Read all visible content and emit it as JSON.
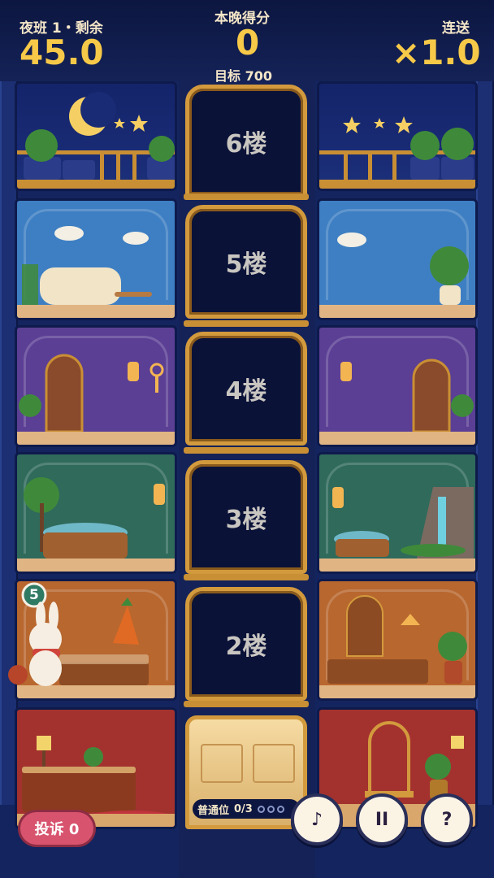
{
  "hud": {
    "shift_label": "夜班 1・剩余",
    "time_left": "45.0",
    "score_label": "本晚得分",
    "score": "0",
    "target_label": "目标 700",
    "combo_label": "连送",
    "combo_value": "×1.0"
  },
  "floors": [
    {
      "label": "6楼"
    },
    {
      "label": "5楼"
    },
    {
      "label": "4楼"
    },
    {
      "label": "3楼"
    },
    {
      "label": "2楼"
    }
  ],
  "elevator": {
    "capacity_label": "普通位",
    "capacity_value": "0/3",
    "capacity_used": 0,
    "capacity_total": 3
  },
  "guest": {
    "wait_number": "5"
  },
  "complaint": {
    "label": "投诉 0"
  },
  "controls": {
    "music_icon": "♪",
    "pause_icon": "II",
    "help_icon": "?"
  },
  "colors": {
    "accent_gold": "#f7c948",
    "frame_gold": "#d39a3d",
    "complaint_red": "#d8546e"
  }
}
